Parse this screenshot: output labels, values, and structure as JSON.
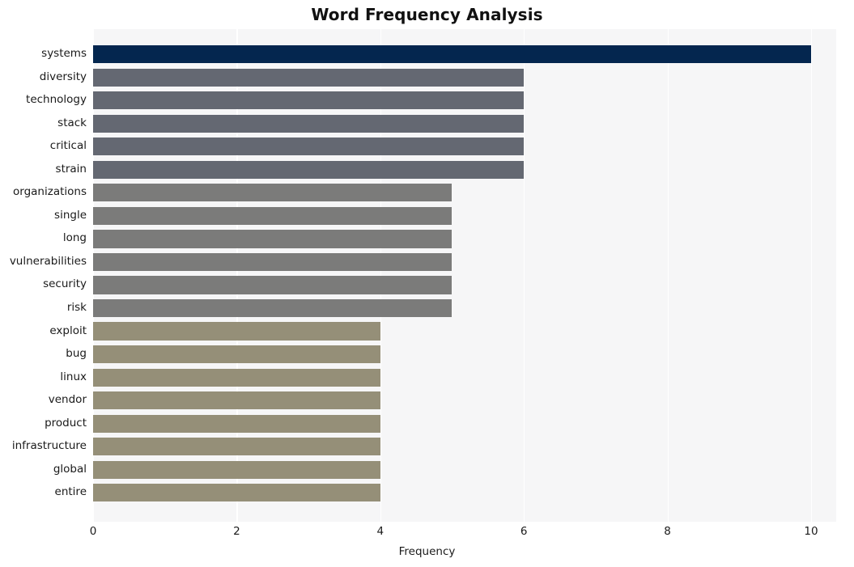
{
  "chart_data": {
    "type": "bar",
    "orientation": "horizontal",
    "title": "Word Frequency Analysis",
    "xlabel": "Frequency",
    "ylabel": "",
    "categories": [
      "systems",
      "diversity",
      "technology",
      "stack",
      "critical",
      "strain",
      "organizations",
      "single",
      "long",
      "vulnerabilities",
      "security",
      "risk",
      "exploit",
      "bug",
      "linux",
      "vendor",
      "product",
      "infrastructure",
      "global",
      "entire"
    ],
    "values": [
      10,
      6,
      6,
      6,
      6,
      6,
      5,
      5,
      5,
      5,
      5,
      5,
      4,
      4,
      4,
      4,
      4,
      4,
      4,
      4
    ],
    "bar_colors": [
      "#04264f",
      "#646872",
      "#646872",
      "#646872",
      "#646872",
      "#646872",
      "#7b7b7a",
      "#7b7b7a",
      "#7b7b7a",
      "#7b7b7a",
      "#7b7b7a",
      "#7b7b7a",
      "#958f78",
      "#958f78",
      "#958f78",
      "#958f78",
      "#958f78",
      "#958f78",
      "#958f78",
      "#958f78"
    ],
    "xlim": [
      0,
      10.35
    ],
    "xticks": [
      0,
      2,
      4,
      6,
      8,
      10
    ],
    "xtick_labels": [
      "0",
      "2",
      "4",
      "6",
      "8",
      "10"
    ],
    "grid": {
      "vertical": true,
      "horizontal": false,
      "color": "#ffffff"
    },
    "plot_background": "#f6f6f7",
    "figure_background": "#ffffff",
    "legend": null
  }
}
